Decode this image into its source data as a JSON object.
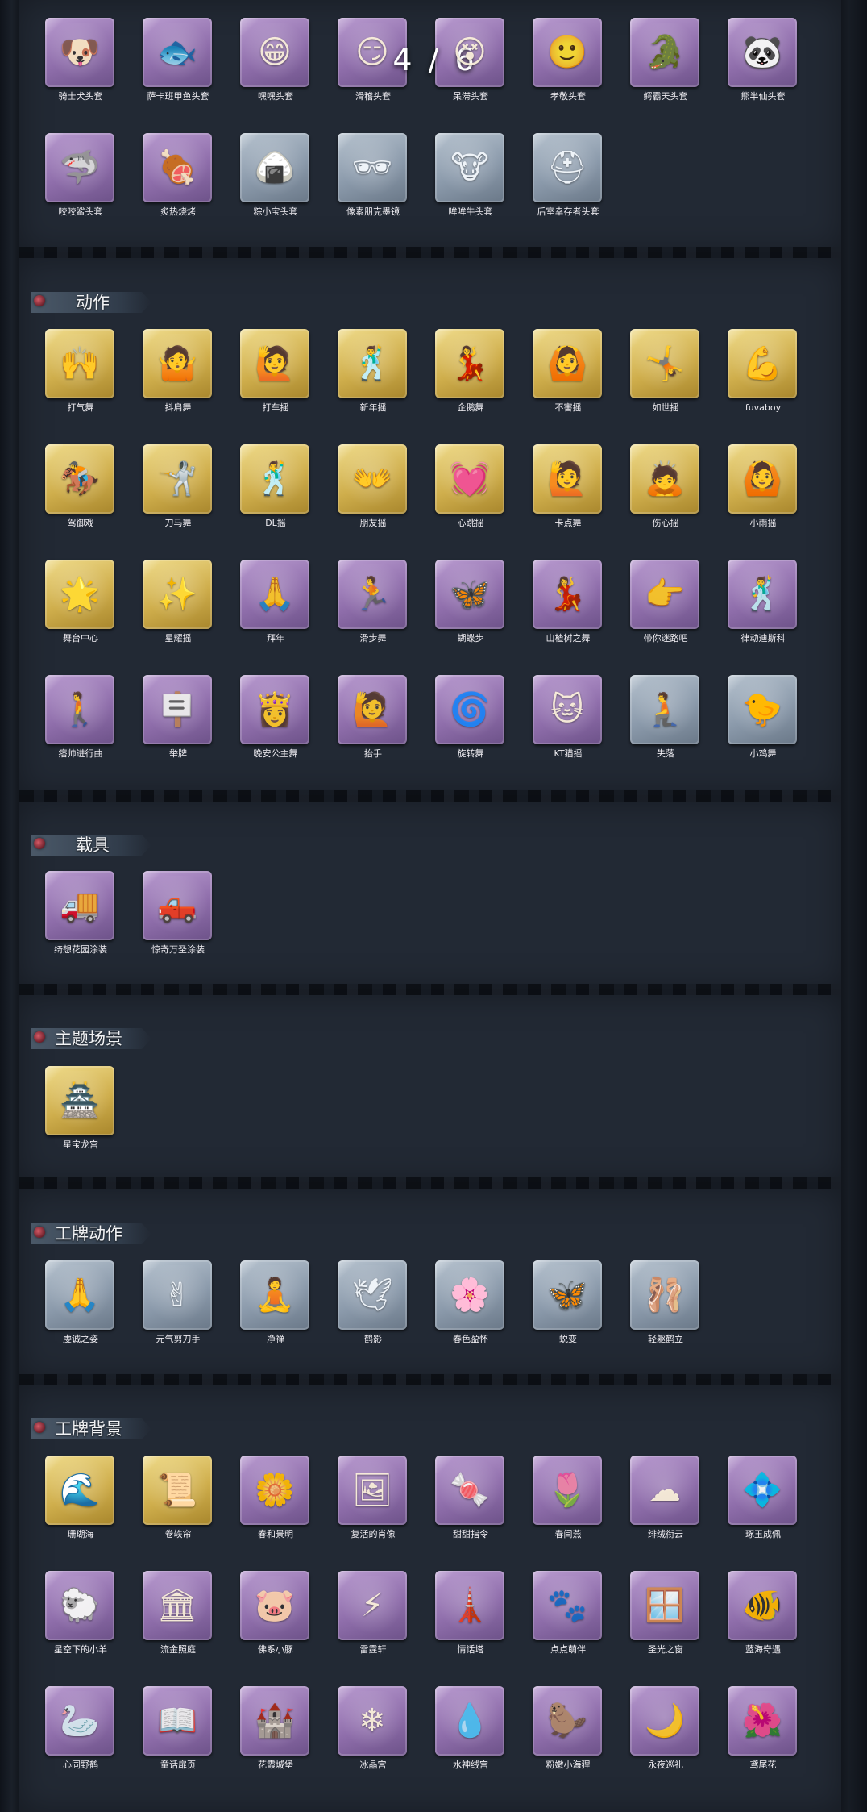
{
  "page_indicator": "4 / 6",
  "sections": {
    "headwear": {
      "items": [
        {
          "label": "骑士犬头套",
          "icon": "dog-icon",
          "glyph": "🐶",
          "rarity": "purple"
        },
        {
          "label": "萨卡班甲鱼头套",
          "icon": "fish-icon",
          "glyph": "🐟",
          "rarity": "purple"
        },
        {
          "label": "嘿嘿头套",
          "icon": "grin-emoji-icon",
          "glyph": "😁",
          "rarity": "purple"
        },
        {
          "label": "滑稽头套",
          "icon": "smirk-emoji-icon",
          "glyph": "😏",
          "rarity": "purple"
        },
        {
          "label": "呆滞头套",
          "icon": "dazed-emoji-icon",
          "glyph": "😵",
          "rarity": "purple"
        },
        {
          "label": "孝敬头套",
          "icon": "smile-emoji-icon",
          "glyph": "🙂",
          "rarity": "purple"
        },
        {
          "label": "鳄霸天头套",
          "icon": "crocodile-icon",
          "glyph": "🐊",
          "rarity": "purple"
        },
        {
          "label": "熊半仙头套",
          "icon": "panda-icon",
          "glyph": "🐼",
          "rarity": "purple"
        },
        {
          "label": "咬咬鲨头套",
          "icon": "shark-icon",
          "glyph": "🦈",
          "rarity": "purple"
        },
        {
          "label": "炙热烧烤",
          "icon": "bbq-icon",
          "glyph": "🍖",
          "rarity": "purple"
        },
        {
          "label": "粽小宝头套",
          "icon": "zongzi-icon",
          "glyph": "🍙",
          "rarity": "gray"
        },
        {
          "label": "像素朋克墨镜",
          "icon": "pixel-sunglasses-icon",
          "glyph": "🕶",
          "rarity": "gray"
        },
        {
          "label": "哞哞牛头套",
          "icon": "cow-icon",
          "glyph": "🐮",
          "rarity": "gray"
        },
        {
          "label": "后室幸存者头套",
          "icon": "helmet-icon",
          "glyph": "⛑",
          "rarity": "gray"
        }
      ]
    },
    "emotes": {
      "title": "动作",
      "items": [
        {
          "label": "打气舞",
          "icon": "cheer-pose-icon",
          "glyph": "🙌",
          "rarity": "gold"
        },
        {
          "label": "抖肩舞",
          "icon": "shoulder-shake-pose-icon",
          "glyph": "🤷",
          "rarity": "gold"
        },
        {
          "label": "打车摇",
          "icon": "taxi-pose-icon",
          "glyph": "🙋",
          "rarity": "gold"
        },
        {
          "label": "新年摇",
          "icon": "new-year-pose-icon",
          "glyph": "🕺",
          "rarity": "gold"
        },
        {
          "label": "企鹅舞",
          "icon": "penguin-pose-icon",
          "glyph": "💃",
          "rarity": "gold"
        },
        {
          "label": "不害摇",
          "icon": "sway-pose-icon",
          "glyph": "🙆",
          "rarity": "gold"
        },
        {
          "label": "如世摇",
          "icon": "dance-pose-icon",
          "glyph": "🤸",
          "rarity": "gold"
        },
        {
          "label": "fuvaboy",
          "icon": "flex-pose-icon",
          "glyph": "💪",
          "rarity": "gold"
        },
        {
          "label": "驾御戏",
          "icon": "ride-pose-icon",
          "glyph": "🏇",
          "rarity": "gold"
        },
        {
          "label": "刀马舞",
          "icon": "blade-dance-pose-icon",
          "glyph": "🤺",
          "rarity": "gold"
        },
        {
          "label": "DL摇",
          "icon": "dl-pose-icon",
          "glyph": "🕺",
          "rarity": "gold"
        },
        {
          "label": "朋友摇",
          "icon": "friend-pose-icon",
          "glyph": "👐",
          "rarity": "gold"
        },
        {
          "label": "心跳摇",
          "icon": "heartbeat-pose-icon",
          "glyph": "💓",
          "rarity": "gold"
        },
        {
          "label": "卡点舞",
          "icon": "beat-pose-icon",
          "glyph": "🙋",
          "rarity": "gold"
        },
        {
          "label": "伤心摇",
          "icon": "sad-pose-icon",
          "glyph": "🙇",
          "rarity": "gold"
        },
        {
          "label": "小雨摇",
          "icon": "rain-pose-icon",
          "glyph": "🙆",
          "rarity": "gold"
        },
        {
          "label": "舞台中心",
          "icon": "stage-pose-icon",
          "glyph": "🌟",
          "rarity": "gold"
        },
        {
          "label": "星耀摇",
          "icon": "star-pose-icon",
          "glyph": "✨",
          "rarity": "gold"
        },
        {
          "label": "拜年",
          "icon": "bow-pose-icon",
          "glyph": "🙏",
          "rarity": "purple"
        },
        {
          "label": "滑步舞",
          "icon": "slide-pose-icon",
          "glyph": "🏃",
          "rarity": "purple"
        },
        {
          "label": "蝴蝶步",
          "icon": "butterfly-pose-icon",
          "glyph": "🦋",
          "rarity": "purple"
        },
        {
          "label": "山楂树之舞",
          "icon": "tree-dance-pose-icon",
          "glyph": "💃",
          "rarity": "purple"
        },
        {
          "label": "带你迷路吧",
          "icon": "lead-pose-icon",
          "glyph": "👉",
          "rarity": "purple"
        },
        {
          "label": "律动迪斯科",
          "icon": "disco-pose-icon",
          "glyph": "🕺",
          "rarity": "purple"
        },
        {
          "label": "痞帅进行曲",
          "icon": "march-pose-icon",
          "glyph": "🚶",
          "rarity": "purple"
        },
        {
          "label": "举牌",
          "icon": "sign-pose-icon",
          "glyph": "🪧",
          "rarity": "purple"
        },
        {
          "label": "晚安公主舞",
          "icon": "princess-pose-icon",
          "glyph": "👸",
          "rarity": "purple"
        },
        {
          "label": "抬手",
          "icon": "raise-hand-pose-icon",
          "glyph": "🙋",
          "rarity": "purple"
        },
        {
          "label": "旋转舞",
          "icon": "spin-pose-icon",
          "glyph": "🌀",
          "rarity": "purple"
        },
        {
          "label": "KT猫摇",
          "icon": "cat-pose-icon",
          "glyph": "🐱",
          "rarity": "purple"
        },
        {
          "label": "失落",
          "icon": "crawl-pose-icon",
          "glyph": "🧎",
          "rarity": "gray"
        },
        {
          "label": "小鸡舞",
          "icon": "chick-pose-icon",
          "glyph": "🐤",
          "rarity": "gray"
        }
      ]
    },
    "vehicles": {
      "title": "载具",
      "items": [
        {
          "label": "绮想花园涂装",
          "icon": "ice-cream-truck-icon",
          "glyph": "🚚",
          "rarity": "purple"
        },
        {
          "label": "惊奇万圣涂装",
          "icon": "halloween-truck-icon",
          "glyph": "🛻",
          "rarity": "purple"
        }
      ]
    },
    "themes": {
      "title": "主题场景",
      "items": [
        {
          "label": "星宝龙宫",
          "icon": "dragon-palace-scene-icon",
          "glyph": "🏯",
          "rarity": "gold"
        }
      ]
    },
    "badge_actions": {
      "title": "工牌动作",
      "items": [
        {
          "label": "虔诚之姿",
          "icon": "pray-silhouette-icon",
          "glyph": "🙏",
          "rarity": "gray"
        },
        {
          "label": "元气剪刀手",
          "icon": "peace-sign-silhouette-icon",
          "glyph": "✌",
          "rarity": "gray"
        },
        {
          "label": "净禅",
          "icon": "meditate-silhouette-icon",
          "glyph": "🧘",
          "rarity": "gray"
        },
        {
          "label": "鹤影",
          "icon": "crane-silhouette-icon",
          "glyph": "🕊",
          "rarity": "gray"
        },
        {
          "label": "春色盈怀",
          "icon": "spring-silhouette-icon",
          "glyph": "🌸",
          "rarity": "gray"
        },
        {
          "label": "蜕变",
          "icon": "transform-silhouette-icon",
          "glyph": "🦋",
          "rarity": "gray"
        },
        {
          "label": "轻躯鹤立",
          "icon": "stand-silhouette-icon",
          "glyph": "🩰",
          "rarity": "gray"
        }
      ]
    },
    "badge_backgrounds": {
      "title": "工牌背景",
      "items": [
        {
          "label": "珊瑚海",
          "icon": "coral-sea-card-icon",
          "glyph": "🌊",
          "rarity": "gold"
        },
        {
          "label": "卷轶帘",
          "icon": "scroll-curtain-card-icon",
          "glyph": "📜",
          "rarity": "gold"
        },
        {
          "label": "春和景明",
          "icon": "spring-card-icon",
          "glyph": "🌼",
          "rarity": "purple"
        },
        {
          "label": "复活的肖像",
          "icon": "portrait-card-icon",
          "glyph": "🖼",
          "rarity": "purple"
        },
        {
          "label": "甜甜指令",
          "icon": "sweet-card-icon",
          "glyph": "🍬",
          "rarity": "purple"
        },
        {
          "label": "春闫燕",
          "icon": "swallow-card-icon",
          "glyph": "🌷",
          "rarity": "purple"
        },
        {
          "label": "绯绒衔云",
          "icon": "cloud-card-icon",
          "glyph": "☁",
          "rarity": "purple"
        },
        {
          "label": "琢玉成佩",
          "icon": "jade-card-icon",
          "glyph": "💠",
          "rarity": "purple"
        },
        {
          "label": "星空下的小羊",
          "icon": "sheep-card-icon",
          "glyph": "🐑",
          "rarity": "purple"
        },
        {
          "label": "流金照庭",
          "icon": "golden-court-card-icon",
          "glyph": "🏛",
          "rarity": "purple"
        },
        {
          "label": "佛系小豚",
          "icon": "piglet-card-icon",
          "glyph": "🐷",
          "rarity": "purple"
        },
        {
          "label": "雷霆轩",
          "icon": "thunder-card-icon",
          "glyph": "⚡",
          "rarity": "purple"
        },
        {
          "label": "情话塔",
          "icon": "tower-card-icon",
          "glyph": "🗼",
          "rarity": "purple"
        },
        {
          "label": "点点萌伴",
          "icon": "dots-card-icon",
          "glyph": "🐾",
          "rarity": "purple"
        },
        {
          "label": "圣光之窗",
          "icon": "holy-window-card-icon",
          "glyph": "🪟",
          "rarity": "purple"
        },
        {
          "label": "蓝海奇遇",
          "icon": "blue-sea-card-icon",
          "glyph": "🐠",
          "rarity": "purple"
        },
        {
          "label": "心同野鹤",
          "icon": "crane-card-icon",
          "glyph": "🦢",
          "rarity": "purple"
        },
        {
          "label": "童话扉页",
          "icon": "fairytale-card-icon",
          "glyph": "📖",
          "rarity": "purple"
        },
        {
          "label": "花霞城堡",
          "icon": "castle-card-icon",
          "glyph": "🏰",
          "rarity": "purple"
        },
        {
          "label": "冰晶宫",
          "icon": "ice-palace-card-icon",
          "glyph": "❄",
          "rarity": "purple"
        },
        {
          "label": "水神绒宫",
          "icon": "water-palace-card-icon",
          "glyph": "💧",
          "rarity": "purple"
        },
        {
          "label": "粉嫩小海狸",
          "icon": "beaver-card-icon",
          "glyph": "🦫",
          "rarity": "purple"
        },
        {
          "label": "永夜巡礼",
          "icon": "eternal-night-card-icon",
          "glyph": "🌙",
          "rarity": "purple"
        },
        {
          "label": "鸢尾花",
          "icon": "iris-card-icon",
          "glyph": "🌺",
          "rarity": "purple"
        }
      ]
    }
  }
}
